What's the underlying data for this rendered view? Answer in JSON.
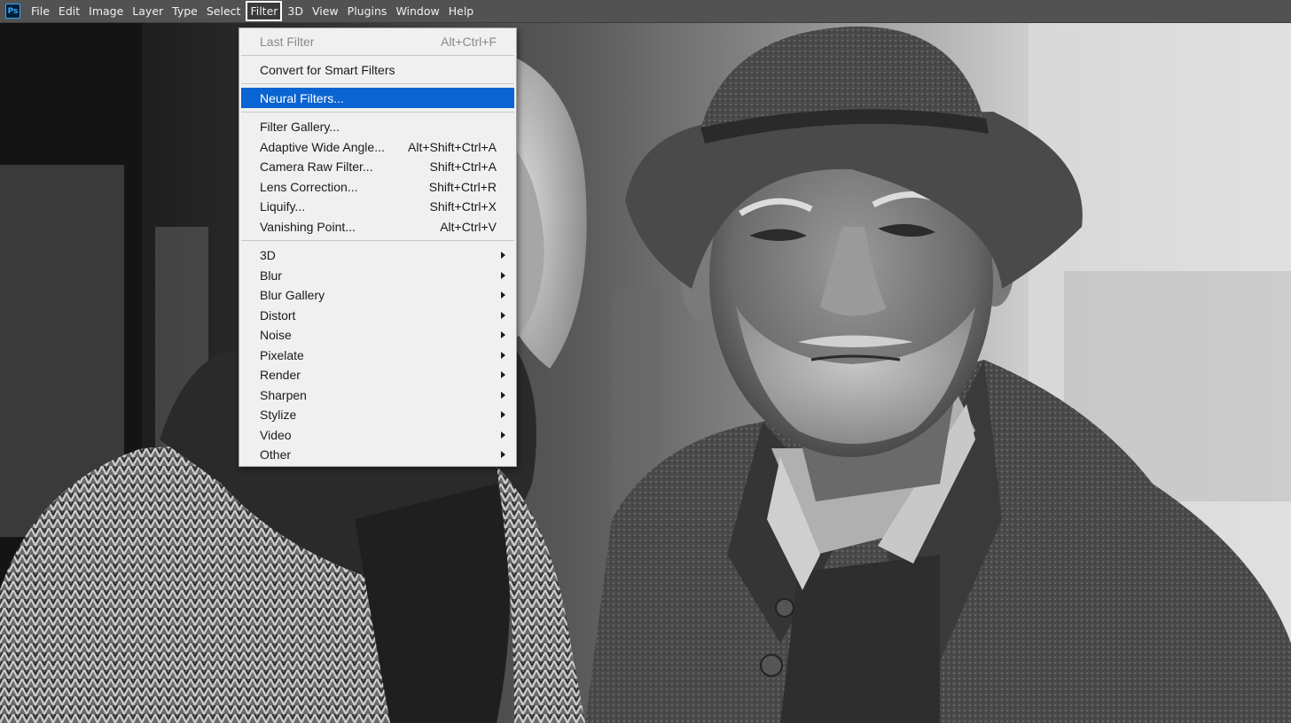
{
  "app": {
    "logo": "Ps",
    "menu": [
      "File",
      "Edit",
      "Image",
      "Layer",
      "Type",
      "Select",
      "Filter",
      "3D",
      "View",
      "Plugins",
      "Window",
      "Help"
    ],
    "active_menu": "Filter"
  },
  "filter_menu": {
    "last_filter": {
      "label": "Last Filter",
      "shortcut": "Alt+Ctrl+F"
    },
    "convert_smart": {
      "label": "Convert for Smart Filters"
    },
    "neural": {
      "label": "Neural Filters..."
    },
    "group_filters": [
      {
        "label": "Filter Gallery...",
        "shortcut": ""
      },
      {
        "label": "Adaptive Wide Angle...",
        "shortcut": "Alt+Shift+Ctrl+A"
      },
      {
        "label": "Camera Raw Filter...",
        "shortcut": "Shift+Ctrl+A"
      },
      {
        "label": "Lens Correction...",
        "shortcut": "Shift+Ctrl+R"
      },
      {
        "label": "Liquify...",
        "shortcut": "Shift+Ctrl+X"
      },
      {
        "label": "Vanishing Point...",
        "shortcut": "Alt+Ctrl+V"
      }
    ],
    "submenus": [
      "3D",
      "Blur",
      "Blur Gallery",
      "Distort",
      "Noise",
      "Pixelate",
      "Render",
      "Sharpen",
      "Stylize",
      "Video",
      "Other"
    ]
  },
  "colors": {
    "menubar_bg": "#525252",
    "dropdown_bg": "#f0f0f0",
    "highlight": "#0a64d2"
  },
  "canvas": {
    "image": "black-and-white photograph of an elderly couple"
  }
}
